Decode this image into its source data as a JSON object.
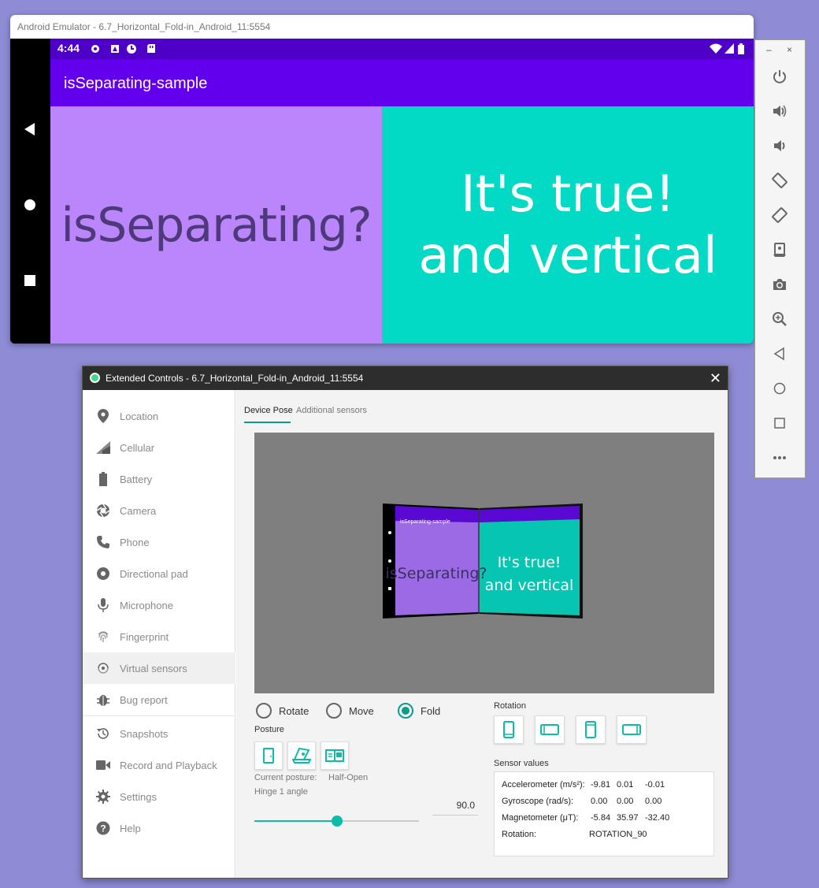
{
  "emulator": {
    "window_title": "Android Emulator - 6.7_Horizontal_Fold-in_Android_11:5554",
    "status_bar": {
      "time": "4:44"
    },
    "app_title": "isSeparating-sample",
    "left_pane_text": "isSeparating?",
    "right_pane_line1": "It's true!",
    "right_pane_line2": "and vertical",
    "colors": {
      "status_bar": "#4e00c9",
      "app_bar": "#6200ee",
      "left_pane": "#bb86fc",
      "right_pane": "#03dac5"
    }
  },
  "toolbar": {
    "minimize": "–",
    "close": "×",
    "icons": [
      "power-icon",
      "volume-up-icon",
      "volume-down-icon",
      "rotate-left-icon",
      "rotate-right-icon",
      "screenshot-icon",
      "camera-icon",
      "zoom-icon",
      "back-icon",
      "home-icon",
      "overview-icon",
      "more-icon"
    ]
  },
  "extended_controls": {
    "window_title": "Extended Controls - 6.7_Horizontal_Fold-in_Android_11:5554",
    "close": "✕",
    "sidebar": [
      {
        "label": "Location",
        "icon": "location-icon"
      },
      {
        "label": "Cellular",
        "icon": "cellular-icon"
      },
      {
        "label": "Battery",
        "icon": "battery-icon"
      },
      {
        "label": "Camera",
        "icon": "camera-icon"
      },
      {
        "label": "Phone",
        "icon": "phone-icon"
      },
      {
        "label": "Directional pad",
        "icon": "dpad-icon"
      },
      {
        "label": "Microphone",
        "icon": "microphone-icon"
      },
      {
        "label": "Fingerprint",
        "icon": "fingerprint-icon"
      },
      {
        "label": "Virtual sensors",
        "icon": "virtual-sensors-icon",
        "active": true
      },
      {
        "label": "Bug report",
        "icon": "bug-icon"
      },
      {
        "label": "Snapshots",
        "icon": "snapshots-icon"
      },
      {
        "label": "Record and Playback",
        "icon": "record-icon"
      },
      {
        "label": "Settings",
        "icon": "settings-icon"
      },
      {
        "label": "Help",
        "icon": "help-icon"
      }
    ],
    "tabs": [
      "Device Pose",
      "Additional sensors"
    ],
    "preview": {
      "app_title": "isSeparating-sample",
      "left_text": "isSeparating?",
      "right_line1": "It's true!",
      "right_line2": "and vertical"
    },
    "modes": [
      {
        "label": "Rotate",
        "selected": false
      },
      {
        "label": "Move",
        "selected": false
      },
      {
        "label": "Fold",
        "selected": true
      }
    ],
    "posture_label": "Posture",
    "current_posture_label": "Current posture:",
    "current_posture_value": "Half-Open",
    "hinge_label": "Hinge 1 angle",
    "hinge_value": "90.0",
    "hinge_fraction": 0.5,
    "rotation_label": "Rotation",
    "sensor_values_label": "Sensor values",
    "sensors": {
      "accelerometer": {
        "label": "Accelerometer (m/s²):",
        "v1": "-9.81",
        "v2": "0.01",
        "v3": "-0.01"
      },
      "gyroscope": {
        "label": "Gyroscope (rad/s):",
        "v1": "0.00",
        "v2": "0.00",
        "v3": "0.00"
      },
      "magnetometer": {
        "label": "Magnetometer (μT):",
        "v1": "-5.84",
        "v2": "35.97",
        "v3": "-32.40"
      },
      "rotation": {
        "label": "Rotation:",
        "value": "ROTATION_90"
      }
    },
    "accent_color": "#0cbba8"
  }
}
